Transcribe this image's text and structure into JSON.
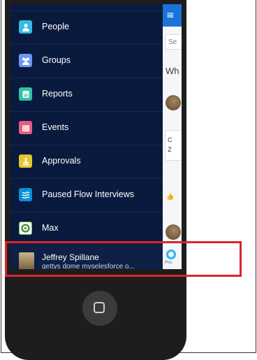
{
  "nav": {
    "items": [
      {
        "label": "People",
        "icon": "person-icon",
        "color": "#34bce2"
      },
      {
        "label": "Groups",
        "icon": "groups-icon",
        "color": "#6c98f4"
      },
      {
        "label": "Reports",
        "icon": "report-icon",
        "color": "#2dc4a5"
      },
      {
        "label": "Events",
        "icon": "calendar-icon",
        "color": "#eb5a84"
      },
      {
        "label": "Approvals",
        "icon": "approval-icon",
        "color": "#e6c630"
      },
      {
        "label": "Paused Flow Interviews",
        "icon": "flow-icon",
        "color": "#0b8fd4"
      },
      {
        "label": "Max",
        "icon": "max-app-icon",
        "color": "#6cb33f"
      }
    ],
    "user": {
      "name": "Jeffrey Spillane",
      "subtitle": "gettys dome myselesforce o..."
    }
  },
  "main": {
    "search_placeholder": "Se",
    "heading": "Wh",
    "card_line1": "C",
    "card_line2": "2",
    "post_label": "Pos",
    "like_icon": "like-icon"
  },
  "colors": {
    "accent": "#1a73d9",
    "nav_bg": "#0a1a3e",
    "highlight": "#d9262c"
  }
}
